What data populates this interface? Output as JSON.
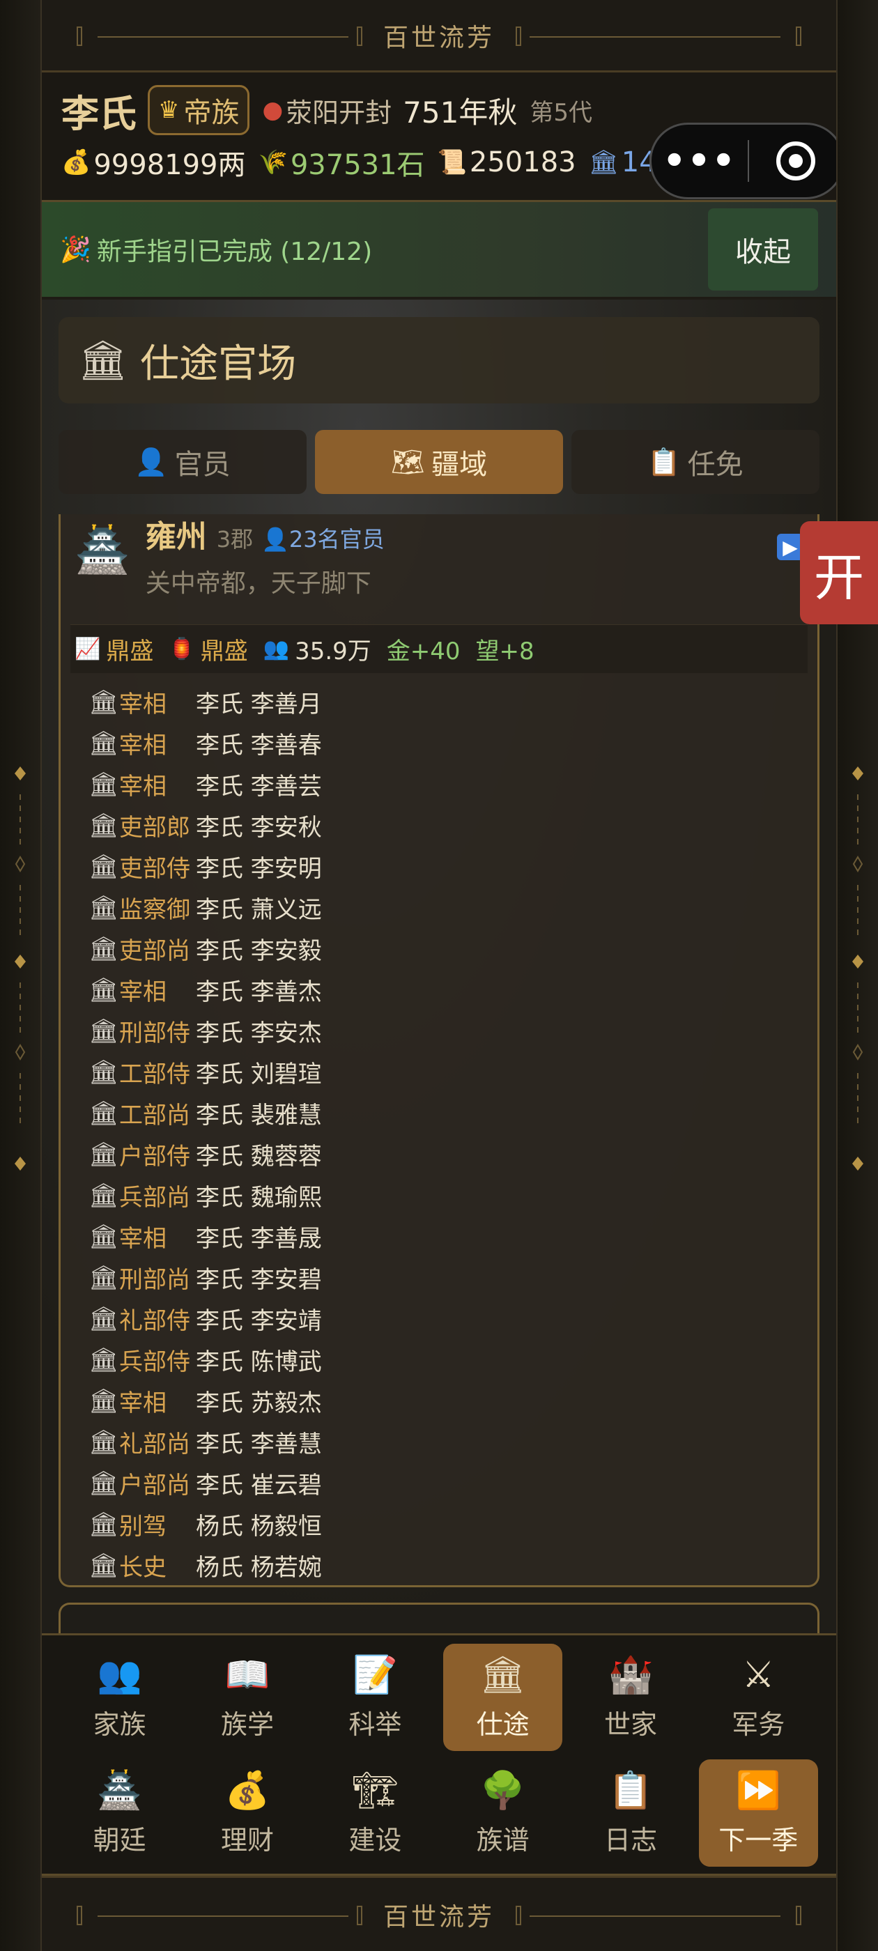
{
  "banner": {
    "title": "百世流芳"
  },
  "header": {
    "clan_name": "李氏",
    "rank_badge": "帝族",
    "location": "荥阳开封",
    "year": "751年秋",
    "generation": "第5代",
    "resources": {
      "money": "9998199两",
      "grain": "937531石",
      "documents": "250183",
      "power": "147814"
    }
  },
  "guide": {
    "text": "新手指引已完成 (12/12)",
    "collapse_label": "收起"
  },
  "page": {
    "title": "仕途官场"
  },
  "tabs": [
    {
      "label": "官员"
    },
    {
      "label": "疆域"
    },
    {
      "label": "任免"
    }
  ],
  "province": {
    "name": "雍州",
    "commanderies": "3郡",
    "officials_count": "23名官员",
    "description": "关中帝都，天子脚下",
    "stats": {
      "trend": "鼎盛",
      "culture": "鼎盛",
      "population": "35.9万",
      "gold_gain": "金+40",
      "prestige_gain": "望+8"
    },
    "officials": [
      {
        "title": "宰相",
        "person": "李氏 李善月"
      },
      {
        "title": "宰相",
        "person": "李氏 李善春"
      },
      {
        "title": "宰相",
        "person": "李氏 李善芸"
      },
      {
        "title": "吏部郎",
        "person": "李氏 李安秋"
      },
      {
        "title": "吏部侍",
        "person": "李氏 李安明"
      },
      {
        "title": "监察御",
        "person": "李氏 萧义远"
      },
      {
        "title": "吏部尚",
        "person": "李氏 李安毅"
      },
      {
        "title": "宰相",
        "person": "李氏 李善杰"
      },
      {
        "title": "刑部侍",
        "person": "李氏 李安杰"
      },
      {
        "title": "工部侍",
        "person": "李氏 刘碧瑄"
      },
      {
        "title": "工部尚",
        "person": "李氏 裴雅慧"
      },
      {
        "title": "户部侍",
        "person": "李氏 魏蓉蓉"
      },
      {
        "title": "兵部尚",
        "person": "李氏 魏瑜熙"
      },
      {
        "title": "宰相",
        "person": "李氏 李善晟"
      },
      {
        "title": "刑部尚",
        "person": "李氏 李安碧"
      },
      {
        "title": "礼部侍",
        "person": "李氏 李安靖"
      },
      {
        "title": "兵部侍",
        "person": "李氏 陈博武"
      },
      {
        "title": "宰相",
        "person": "李氏 苏毅杰"
      },
      {
        "title": "礼部尚",
        "person": "李氏 李善慧"
      },
      {
        "title": "户部尚",
        "person": "李氏 崔云碧"
      },
      {
        "title": "别驾",
        "person": "杨氏 杨毅恒"
      },
      {
        "title": "长史",
        "person": "杨氏 杨若婉"
      }
    ]
  },
  "float_button": {
    "label": "开"
  },
  "nav": {
    "row1": [
      {
        "label": "家族",
        "icon": "family-icon"
      },
      {
        "label": "族学",
        "icon": "book-icon"
      },
      {
        "label": "科举",
        "icon": "exam-icon"
      },
      {
        "label": "仕途",
        "icon": "court-icon"
      },
      {
        "label": "世家",
        "icon": "castle-icon"
      },
      {
        "label": "军务",
        "icon": "swords-icon"
      }
    ],
    "row2": [
      {
        "label": "朝廷",
        "icon": "palace-icon"
      },
      {
        "label": "理财",
        "icon": "moneybag-icon"
      },
      {
        "label": "建设",
        "icon": "crane-icon"
      },
      {
        "label": "族谱",
        "icon": "tree-icon"
      },
      {
        "label": "日志",
        "icon": "clipboard-icon"
      },
      {
        "label": "下一季",
        "icon": "fast-forward-icon"
      }
    ]
  }
}
